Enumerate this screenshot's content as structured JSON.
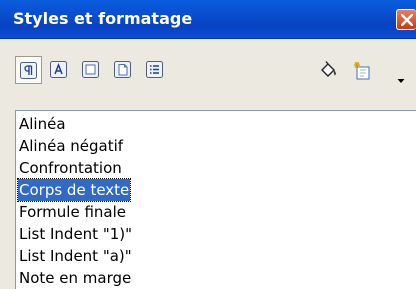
{
  "window": {
    "title": "Styles et formatage"
  },
  "toolbar": {
    "buttons": [
      {
        "icon": "paragraph-styles-icon",
        "active": true
      },
      {
        "icon": "character-styles-icon",
        "active": false
      },
      {
        "icon": "frame-styles-icon",
        "active": false
      },
      {
        "icon": "page-styles-icon",
        "active": false
      },
      {
        "icon": "list-styles-icon",
        "active": false
      },
      {
        "icon": "fill-format-mode-icon",
        "active": false
      },
      {
        "icon": "new-style-from-selection-icon",
        "active": false
      }
    ]
  },
  "styles_list": {
    "items": [
      "Alinéa",
      "Alinéa négatif",
      "Confrontation",
      "Corps de texte",
      "Formule finale",
      "List Indent \"1)\"",
      "List Indent \"a)\"",
      "Note en marge"
    ],
    "selected": "Corps de texte"
  },
  "colors": {
    "titlebar": "#0a4fd0",
    "selection": "#316ac5",
    "panel": "#eceae0"
  }
}
